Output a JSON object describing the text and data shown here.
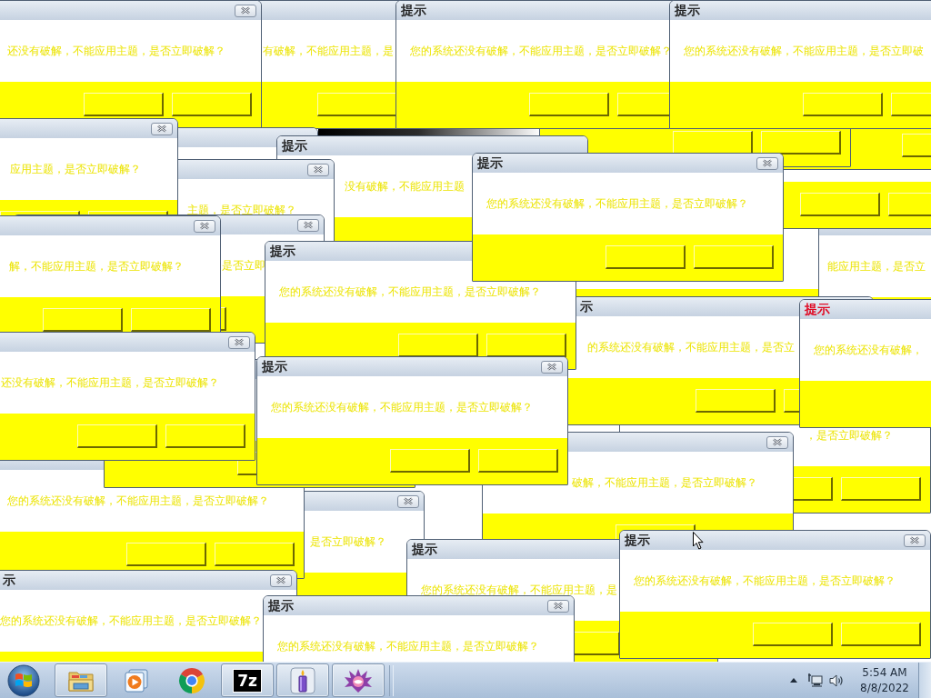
{
  "windows": [
    {
      "message": "还没有破解，不能应用主题，是否立即破解？"
    },
    {
      "message": "有破解，不能应用主题，是"
    },
    {
      "title": "提示",
      "color": "#1c1c1c",
      "message": "您的系统还没有破解，不能应用主题，是否立即破解？"
    },
    {
      "title": "提示",
      "color": "#1c1c1c",
      "message": "您的系统还没有破解，不能应用主题，是否立即破"
    },
    {
      "message": "应用主题，是否立即破解？"
    },
    {
      "title": "提示",
      "color": "#1c1c1c",
      "message": "没有破解，不能应用主题"
    },
    {
      "message": "主题，是否立即破解？"
    },
    {
      "title": "提示",
      "color": "#1c1c1c",
      "message": "您的系统还没有破解，不能应用主题，是否立即破解？"
    },
    {
      "message": "解，不能应用主题，是否立即破解？"
    },
    {
      "message": "是否立即"
    },
    {
      "title": "提示",
      "color": "#1c1c1c",
      "message": "您的系统还没有破解，不能应用主题，是否立即破解？"
    },
    {
      "message": "能应用主题，是否立"
    },
    {
      "title": "示",
      "color": "#1c1c1c",
      "message": "的系统还没有破解，不能应用主题，是否立"
    },
    {
      "title": "提示",
      "color": "#e0001b",
      "message": "您的系统还没有破解，"
    },
    {
      "message": "还没有破解，不能应用主题，是否立即破解？"
    },
    {
      "title": "提示",
      "color": "#1c1c1c",
      "message": "您的系统还没有破解，不能应用主题，是否立即破解？"
    },
    {
      "message": "，是否立即破解？"
    },
    {
      "message": "破解，不能应用主题，是否立即破解？"
    },
    {
      "message": "您的系统还没有破解，不能应用主题，是否立即破解？"
    },
    {
      "message": "是否立即破解？"
    },
    {
      "title": "提示",
      "color": "#1c1c1c",
      "message": "您的系统还没有破解，不能应用主题，是"
    },
    {
      "title": "提示",
      "color": "#1c1c1c",
      "message": "您的系统还没有破解，不能应用主题，是否立即破解？"
    },
    {
      "title": "示",
      "color": "#1c1c1c",
      "message": "您的系统还没有破解，不能应用主题，是否立即破解？"
    },
    {
      "title": "提示",
      "color": "#1c1c1c",
      "message": "您的系统还没有破解，不能应用主题，是否立即破解？"
    }
  ],
  "taskbar": {
    "apps": [
      {
        "kind": "explorer",
        "running": true
      },
      {
        "kind": "media",
        "running": false
      },
      {
        "kind": "browser",
        "running": false
      },
      {
        "kind": "archiver",
        "running": true,
        "logo": "7z"
      },
      {
        "kind": "candle",
        "running": true
      },
      {
        "kind": "flower",
        "running": true
      }
    ],
    "clock": {
      "time": "5:54 AM",
      "date": "8/8/2022"
    }
  }
}
